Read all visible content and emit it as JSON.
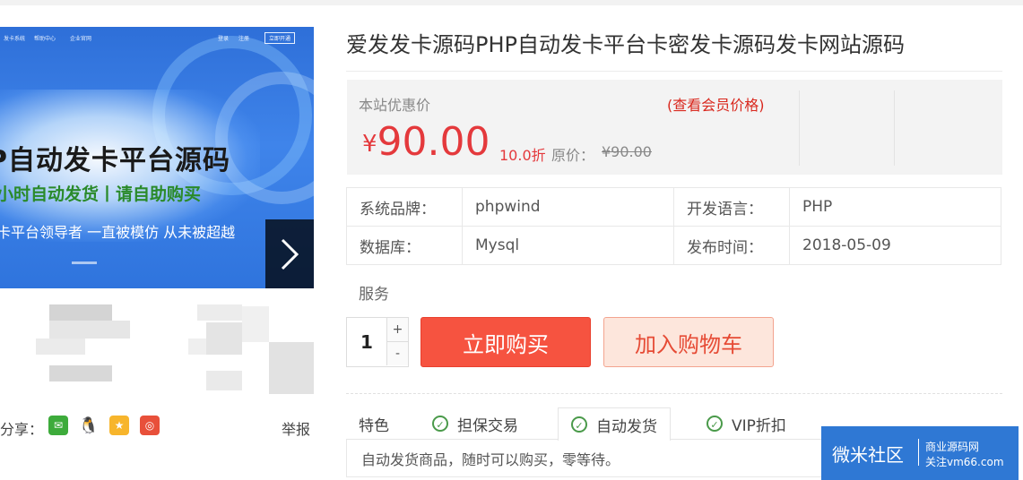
{
  "banner": {
    "nav_items": [
      "发卡系统",
      "帮助中心",
      "企业官网",
      "登录",
      "注册"
    ],
    "nav_button": "立即开通",
    "headline": "P自动发卡平台源码",
    "subline": "小时自动发货丨请自助购买",
    "tagline": "卡平台领导者  一直被模仿  从未被超越",
    "next_icon": "chevron-right-icon"
  },
  "share": {
    "label": "分享：",
    "icons": [
      "wechat-icon",
      "qq-icon",
      "qzone-icon",
      "weibo-icon"
    ],
    "report": "举报"
  },
  "product": {
    "title": "爱发发卡源码PHP自动发卡平台卡密发卡源码发卡网站源码"
  },
  "price": {
    "label": "本站优惠价",
    "member_link": "(查看会员价格)",
    "currency": "¥",
    "value": "90.00",
    "discount": "10.0折",
    "original_label": "原价：",
    "original_value": "¥90.00"
  },
  "specs": {
    "rows": [
      {
        "k1": "系统品牌：",
        "v1": "phpwind",
        "k2": "开发语言：",
        "v2": "PHP"
      },
      {
        "k1": "数据库：",
        "v1": "Mysql",
        "k2": "发布时间：",
        "v2": "2018-05-09"
      }
    ]
  },
  "service": {
    "label": "服务"
  },
  "purchase": {
    "quantity": "1",
    "plus": "+",
    "minus": "-",
    "buy_label": "立即购买",
    "cart_label": "加入购物车"
  },
  "tabs": {
    "lead": "特色",
    "items": [
      "担保交易",
      "自动发货",
      "VIP折扣"
    ],
    "active_index": 1,
    "description": "自动发货商品，随时可以购买，零等待。"
  },
  "watermark": {
    "brand": "微米社区",
    "line1": "商业源码网",
    "line2": "关注vm66.com"
  },
  "colors": {
    "accent_red": "#e4393c",
    "buy_button": "#f65340",
    "cart_button": "#fde6dc",
    "check_green": "#4a9a4a",
    "watermark_blue": "#2f78d4"
  }
}
